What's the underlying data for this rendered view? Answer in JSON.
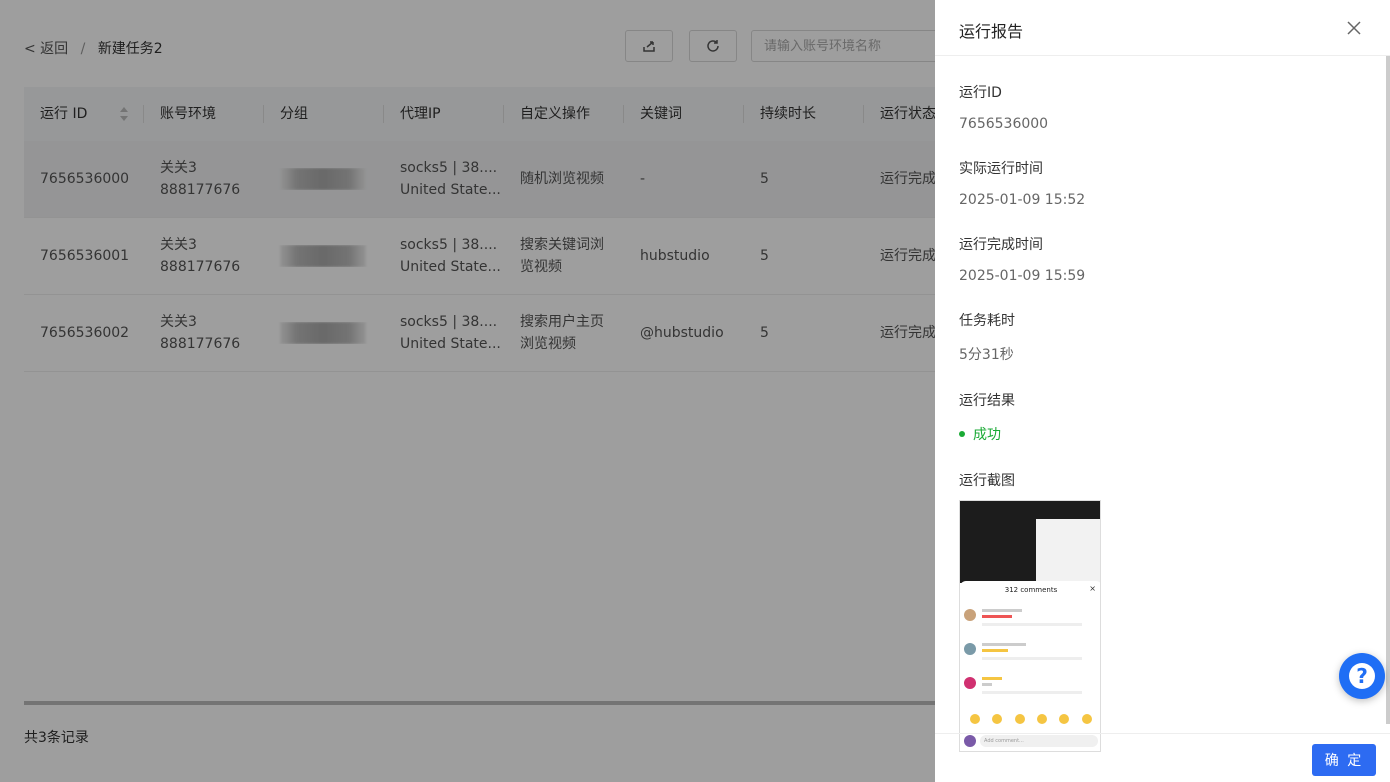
{
  "breadcrumb": {
    "back": "< 返回",
    "separator": "/",
    "current": "新建任务2"
  },
  "search": {
    "placeholder": "请输入账号环境名称"
  },
  "table": {
    "columns": [
      "运行 ID",
      "账号环境",
      "分组",
      "代理IP",
      "自定义操作",
      "关键词",
      "持续时长",
      "运行状态"
    ],
    "rows": [
      {
        "id": "7656536000",
        "env_name": "关关3",
        "env_id": "888177676",
        "proxy_line1": "socks5 | 38....",
        "proxy_line2": "United State...",
        "op_line1": "随机浏览视频",
        "op_line2": "",
        "keyword": "-",
        "duration": "5",
        "status": "运行完成"
      },
      {
        "id": "7656536001",
        "env_name": "关关3",
        "env_id": "888177676",
        "proxy_line1": "socks5 | 38....",
        "proxy_line2": "United State...",
        "op_line1": "搜索关键词浏",
        "op_line2": "览视频",
        "keyword": "hubstudio",
        "duration": "5",
        "status": "运行完成"
      },
      {
        "id": "7656536002",
        "env_name": "关关3",
        "env_id": "888177676",
        "proxy_line1": "socks5 | 38....",
        "proxy_line2": "United State...",
        "op_line1": "搜索用户主页",
        "op_line2": "浏览视频",
        "keyword": "@hubstudio",
        "duration": "5",
        "status": "运行完成"
      }
    ]
  },
  "total_text": "共3条记录",
  "drawer": {
    "title": "运行报告",
    "run_id_label": "运行ID",
    "run_id": "7656536000",
    "start_label": "实际运行时间",
    "start": "2025-01-09 15:52",
    "end_label": "运行完成时间",
    "end": "2025-01-09 15:59",
    "cost_label": "任务耗时",
    "cost": "5分31秒",
    "result_label": "运行结果",
    "result": "成功",
    "screenshot_label": "运行截图",
    "screenshot": {
      "comments_title": "312 comments",
      "comment_placeholder": "Add comment..."
    },
    "ok": "确 定"
  },
  "help": {
    "icon": "?"
  },
  "colors": {
    "primary": "#2d6bf2",
    "success": "#1aaa35",
    "help": "#1f6ef5"
  }
}
